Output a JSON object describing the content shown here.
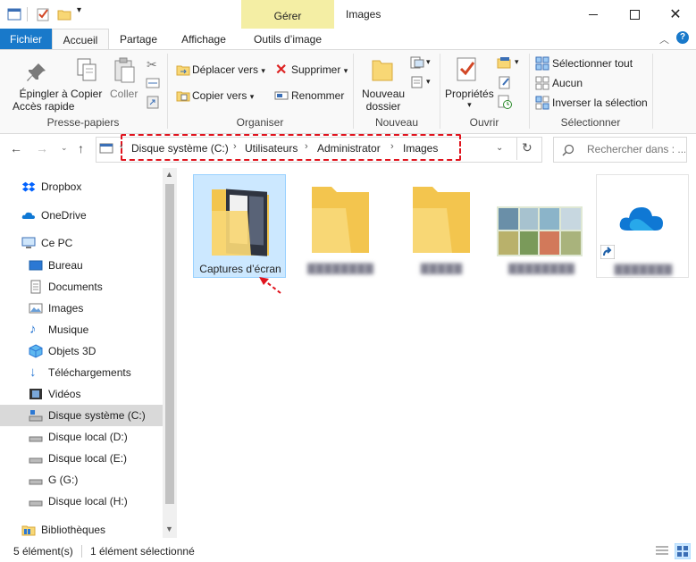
{
  "window": {
    "title": "Images",
    "contextual_tab": "Gérer"
  },
  "ribbon_tabs": {
    "fichier": "Fichier",
    "accueil": "Accueil",
    "partage": "Partage",
    "affichage": "Affichage",
    "outils_image": "Outils d’image"
  },
  "ribbon": {
    "presse_papiers": {
      "label": "Presse-papiers",
      "epingler_l1": "Épingler à",
      "epingler_l2": "Accès rapide",
      "copier": "Copier",
      "coller": "Coller"
    },
    "organiser": {
      "label": "Organiser",
      "deplacer": "Déplacer vers",
      "copier_vers": "Copier vers",
      "supprimer": "Supprimer",
      "renommer": "Renommer"
    },
    "nouveau": {
      "label": "Nouveau",
      "nouveau_l1": "Nouveau",
      "nouveau_l2": "dossier"
    },
    "ouvrir": {
      "label": "Ouvrir",
      "proprietes": "Propriétés"
    },
    "selectionner": {
      "label": "Sélectionner",
      "tout": "Sélectionner tout",
      "aucun": "Aucun",
      "inverser": "Inverser la sélection"
    }
  },
  "address": {
    "crumbs": [
      "Disque système (C:)",
      "Utilisateurs",
      "Administrator",
      "Images"
    ]
  },
  "search": {
    "placeholder": "Rechercher dans : ..."
  },
  "nav": {
    "items": [
      {
        "label": "Dropbox"
      },
      {
        "label": "OneDrive"
      },
      {
        "label": "Ce PC"
      },
      {
        "label": "Bureau"
      },
      {
        "label": "Documents"
      },
      {
        "label": "Images"
      },
      {
        "label": "Musique"
      },
      {
        "label": "Objets 3D"
      },
      {
        "label": "Téléchargements"
      },
      {
        "label": "Vidéos"
      },
      {
        "label": "Disque système (C:)"
      },
      {
        "label": "Disque local (D:)"
      },
      {
        "label": "Disque local (E:)"
      },
      {
        "label": "G (G:)"
      },
      {
        "label": "Disque local (H:)"
      },
      {
        "label": "Bibliothèques"
      }
    ]
  },
  "files": {
    "selected_label": "Captures d’écran"
  },
  "status": {
    "count": "5 élément(s)",
    "selection": "1 élément sélectionné"
  },
  "colors": {
    "accent": "#1979ca",
    "contextual_tab": "#f4eea4",
    "selection": "#cce8ff",
    "highlight_dash": "#e0141e",
    "folder": "#f8d775"
  }
}
